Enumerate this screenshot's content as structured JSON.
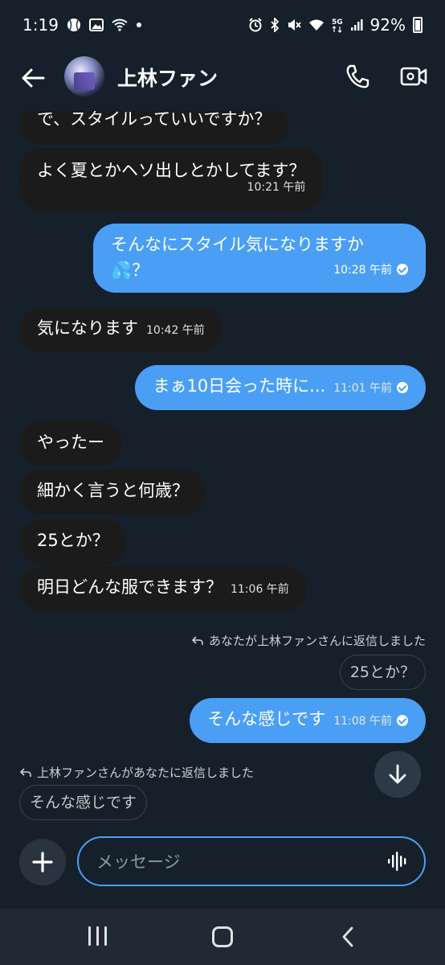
{
  "statusbar": {
    "time": "1:19",
    "battery": "92%"
  },
  "header": {
    "title": "上林ファン"
  },
  "messages": [
    {
      "dir": "in",
      "text": "で、スタイルっていいですか？",
      "time": ""
    },
    {
      "dir": "in",
      "text": "よく夏とかヘソ出しとかしてます？",
      "time": "10:21 午前"
    },
    {
      "dir": "out",
      "text_line1": "そんなにスタイル気になりますか",
      "text_line2": "💦？",
      "time": "10:28 午前"
    },
    {
      "dir": "in",
      "text": "気になります",
      "time": "10:42 午前"
    },
    {
      "dir": "out",
      "text": "まぁ10日会った時に...",
      "time": "11:01 午前"
    },
    {
      "dir": "in",
      "text": "やったー",
      "time": ""
    },
    {
      "dir": "in",
      "text": "細かく言うと何歳？",
      "time": ""
    },
    {
      "dir": "in",
      "text": "25とか？",
      "time": ""
    },
    {
      "dir": "in",
      "text": "明日どんな服できます？",
      "time": "11:06 午前"
    },
    {
      "dir": "out",
      "text": "そんな感じです",
      "time": "11:08 午前"
    }
  ],
  "reply1": {
    "note": "あなたが上林ファンさんに返信しました",
    "quote": "25とか？"
  },
  "reply2": {
    "note": "上林ファンさんがあなたに返信しました",
    "quote": "そんな感じです"
  },
  "composer": {
    "placeholder": "メッセージ"
  },
  "colors": {
    "background": "#15202b",
    "incoming_bubble": "#1b1b1b",
    "outgoing_bubble": "#4a9ff5",
    "accent": "#4a9ff5"
  },
  "icons": {
    "back": "arrow-left-icon",
    "call": "phone-icon",
    "video": "video-camera-icon",
    "scroll_down": "arrow-down-icon",
    "add": "plus-icon",
    "voice": "voice-wave-icon"
  }
}
